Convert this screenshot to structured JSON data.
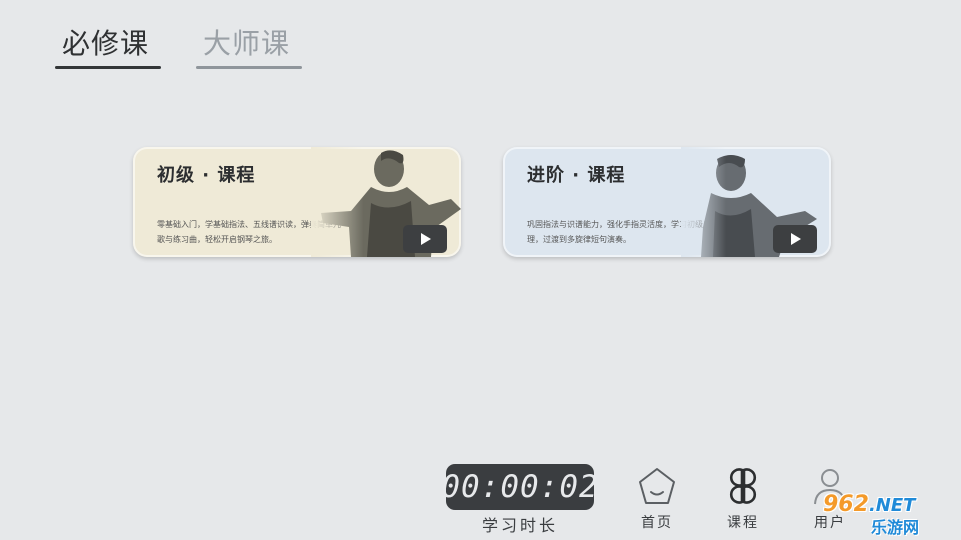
{
  "tabs": [
    {
      "label": "必修课"
    },
    {
      "label": "大师课"
    }
  ],
  "cards": [
    {
      "title": "初级 · 课程",
      "description": "零基础入门，学基础指法、五线谱识读，弹奏简单儿歌与练习曲，轻松开启钢琴之旅。",
      "bg": "#efead7"
    },
    {
      "title": "进阶 · 课程",
      "description": "巩固指法与识谱能力，强化手指灵活度，学习初级乐理，过渡到多旋律短句演奏。",
      "bg": "#dde6ef"
    }
  ],
  "timer": {
    "value": "00:00:02",
    "label": "学习时长"
  },
  "nav": {
    "home": "首页",
    "course": "课程",
    "user": "用户"
  },
  "watermark": {
    "logo": "962",
    "suffix": ".NET",
    "cn": "乐游网"
  }
}
